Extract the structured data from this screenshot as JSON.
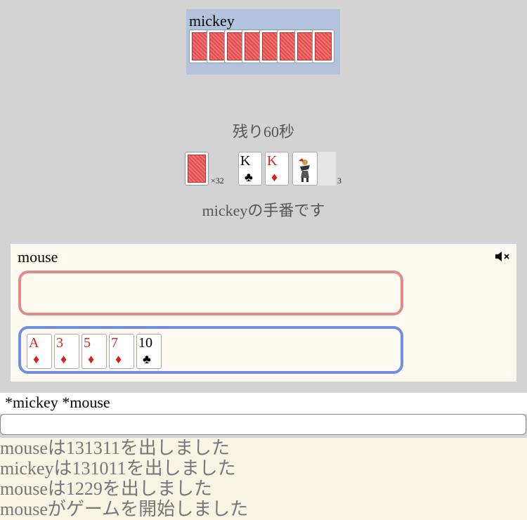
{
  "opponent": {
    "name": "mickey",
    "card_count": 8
  },
  "timer_text": "残り60秒",
  "deck": {
    "multiplier": "×32"
  },
  "field_cards": [
    {
      "rank": "K",
      "suit": "♣",
      "color": "black"
    },
    {
      "rank": "K",
      "suit": "♦",
      "color": "red"
    }
  ],
  "discard_count": "3",
  "turn_text": "mickeyの手番です",
  "player": {
    "name": "mouse",
    "hand": [
      {
        "rank": "A",
        "suit": "♦",
        "color": "red"
      },
      {
        "rank": "3",
        "suit": "♦",
        "color": "red"
      },
      {
        "rank": "5",
        "suit": "♦",
        "color": "red"
      },
      {
        "rank": "7",
        "suit": "♦",
        "color": "red"
      },
      {
        "rank": "10",
        "suit": "♣",
        "color": "black"
      }
    ]
  },
  "players_line": "*mickey  *mouse",
  "chat_placeholder": "",
  "log": [
    "mouseは131311を出しました",
    "mickeyは131011を出しました",
    "mouseは1229を出しました",
    "mouseがゲームを開始しました"
  ],
  "colors": {
    "red": "#d42020",
    "black": "#000000",
    "opponent_bg": "#b4c3dd",
    "zone_red": "#e08b8b",
    "zone_blue": "#6f8fe0"
  }
}
